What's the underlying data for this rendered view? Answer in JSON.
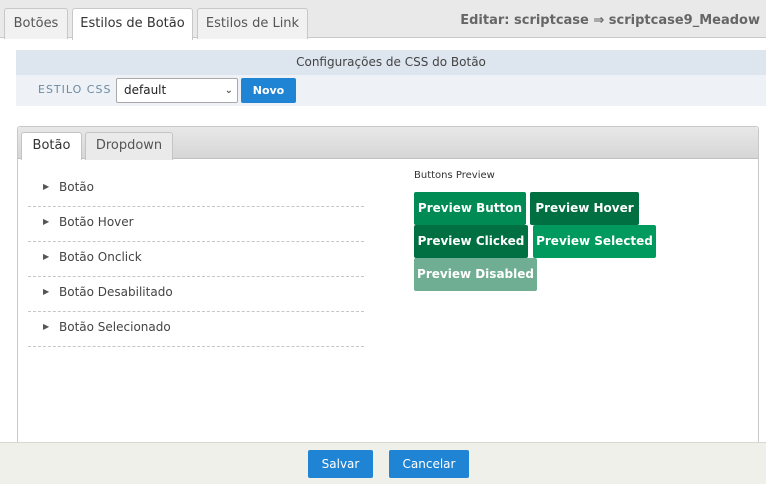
{
  "top_tabs": [
    {
      "label": "Botões"
    },
    {
      "label": "Estilos de Botão"
    },
    {
      "label": "Estilos de Link"
    }
  ],
  "edit_title": "Editar: scriptcase ⇒ scriptcase9_Meadow",
  "config": {
    "header": "Configurações de CSS do Botão",
    "css_label": "ESTILO CSS",
    "css_select_value": "default",
    "new_button": "Novo"
  },
  "panel_tabs": [
    {
      "label": "Botão"
    },
    {
      "label": "Dropdown"
    }
  ],
  "accordion_items": [
    {
      "label": "Botão"
    },
    {
      "label": "Botão Hover"
    },
    {
      "label": "Botão Onclick"
    },
    {
      "label": "Botão Desabilitado"
    },
    {
      "label": "Botão Selecionado"
    }
  ],
  "preview": {
    "title": "Buttons Preview",
    "buttons": [
      {
        "label": "Preview Button",
        "color": "#008a54"
      },
      {
        "label": "Preview Hover",
        "color": "#006f41"
      },
      {
        "label": "Preview Clicked",
        "color": "#006f41"
      },
      {
        "label": "Preview Selected",
        "color": "#009a5e"
      },
      {
        "label": "Preview Disabled",
        "color": "#6fae93"
      }
    ]
  },
  "footer": {
    "save": "Salvar",
    "cancel": "Cancelar"
  },
  "colors": {
    "accent_blue": "#1f84d4",
    "header_bg": "#dde5ee"
  }
}
